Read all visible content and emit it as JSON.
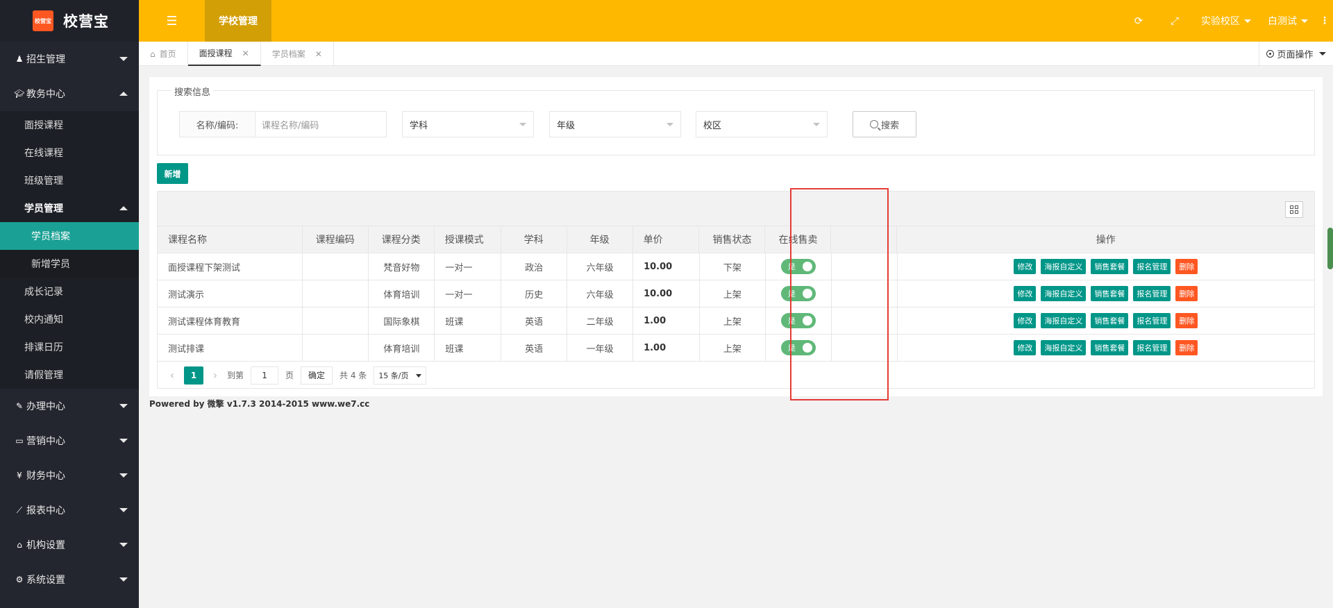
{
  "app": {
    "logo_badge": "校营宝",
    "title": "校营宝"
  },
  "header": {
    "active_tab": "学校管理",
    "campus": "实验校区",
    "user": "白测试",
    "more": "⋮"
  },
  "tabs": [
    {
      "label": "首页",
      "closable": false
    },
    {
      "label": "面授课程",
      "closable": true
    },
    {
      "label": "学员档案",
      "closable": true
    }
  ],
  "page_ops": "页面操作",
  "sidebar": {
    "groups": [
      {
        "label": "招生管理",
        "icon": "user-icon"
      },
      {
        "label": "教务中心",
        "icon": "graduation-cap-icon"
      },
      {
        "label": "办理中心",
        "icon": "edit-icon"
      },
      {
        "label": "营销中心",
        "icon": "laptop-icon"
      },
      {
        "label": "财务中心",
        "icon": "yen-icon"
      },
      {
        "label": "报表中心",
        "icon": "chart-icon"
      },
      {
        "label": "机构设置",
        "icon": "bank-icon"
      },
      {
        "label": "系统设置",
        "icon": "gears-icon"
      }
    ],
    "edu_items": [
      "面授课程",
      "在线课程",
      "班级管理",
      "学员管理",
      "成长记录",
      "校内通知",
      "排课日历",
      "请假管理"
    ],
    "student_items": [
      "学员档案",
      "新增学员"
    ]
  },
  "search": {
    "legend": "搜索信息",
    "name_label": "名称/编码:",
    "name_placeholder": "课程名称/编码",
    "subject": "学科",
    "grade": "年级",
    "campus": "校区",
    "button": "搜索"
  },
  "add_button": "新增",
  "table": {
    "headers": [
      "课程名称",
      "课程编码",
      "课程分类",
      "授课模式",
      "学科",
      "年级",
      "单价",
      "销售状态",
      "在线售卖",
      "操作"
    ],
    "rows": [
      {
        "name": "面授课程下架测试",
        "code": "",
        "category": "梵音好物",
        "mode": "一对一",
        "subject": "政治",
        "grade": "六年级",
        "price": "10.00",
        "status": "下架",
        "online": "是"
      },
      {
        "name": "测试演示",
        "code": "",
        "category": "体育培训",
        "mode": "一对一",
        "subject": "历史",
        "grade": "六年级",
        "price": "10.00",
        "status": "上架",
        "online": "是"
      },
      {
        "name": "测试课程体育教育",
        "code": "",
        "category": "国际象棋",
        "mode": "班课",
        "subject": "英语",
        "grade": "二年级",
        "price": "1.00",
        "status": "上架",
        "online": "是"
      },
      {
        "name": "测试排课",
        "code": "",
        "category": "体育培训",
        "mode": "班课",
        "subject": "英语",
        "grade": "一年级",
        "price": "1.00",
        "status": "上架",
        "online": "是"
      }
    ],
    "actions": [
      "修改",
      "海报自定义",
      "销售套餐",
      "报名管理",
      "删除"
    ]
  },
  "pager": {
    "current": "1",
    "goto_label": "到第",
    "page_input": "1",
    "page_unit": "页",
    "confirm": "确定",
    "total": "共 4 条",
    "per_page": "15 条/页"
  },
  "footer": "Powered by 微擎 v1.7.3 2014-2015 www.we7.cc",
  "colors": {
    "accent": "#009688",
    "header": "#ffb800",
    "danger": "#ff5722",
    "switch_on": "#5fb878",
    "highlight": "#e53935"
  }
}
